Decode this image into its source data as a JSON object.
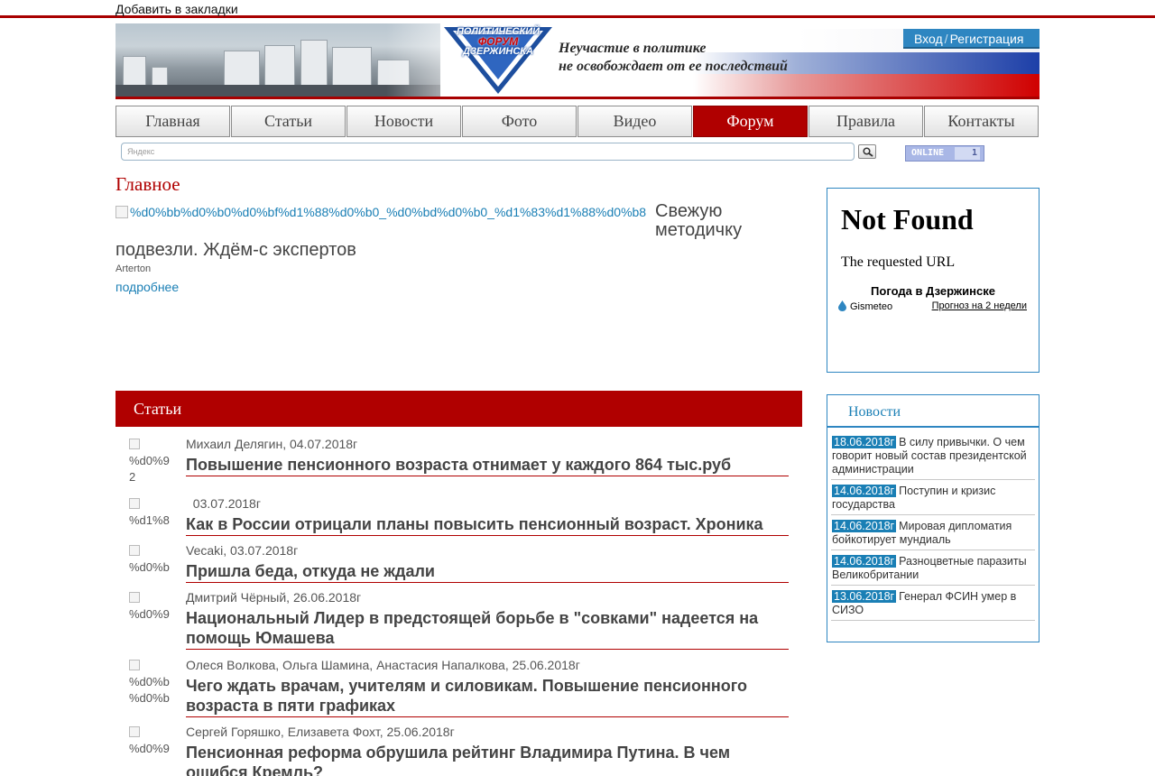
{
  "top": {
    "bookmark": "Добавить в закладки"
  },
  "header": {
    "logo_line1": "ПОЛИТИЧЕСКИЙ",
    "logo_line2": "ФОРУМ",
    "logo_line3": "ДЗЕРЖИНСКА",
    "slogan_line1": "Неучастие в политике",
    "slogan_line2": "не освобождает от ее последствий",
    "login": "Вход",
    "separator": "/",
    "register": "Регистрация"
  },
  "nav": [
    {
      "label": "Главная"
    },
    {
      "label": "Статьи"
    },
    {
      "label": "Новости"
    },
    {
      "label": "Фото"
    },
    {
      "label": "Видео"
    },
    {
      "label": "Форум",
      "active": true
    },
    {
      "label": "Правила"
    },
    {
      "label": "Контакты"
    }
  ],
  "search": {
    "placeholder": "Яндекс"
  },
  "online": {
    "label": "ONLINE",
    "count": "1"
  },
  "featured": {
    "heading": "Главное",
    "image_alt": "%d0%bb%d0%b0%d0%bf%d1%88%d0%b0_%d0%bd%d0%b0_%d1%83%d1%88%d0%b8",
    "title_part1": "Свежую методичку",
    "title_part2": "подвезли. Ждём-с экспертов",
    "author": "Arterton",
    "more": "подробнее"
  },
  "not_found": {
    "title": "Not Found",
    "text": "The requested URL",
    "weather_title": "Погода в Дзержинске",
    "weather_source": "Gismeteo",
    "weather_link": "Прогноз на 2 недели"
  },
  "news": {
    "heading": "Новости",
    "items": [
      {
        "date": "18.06.2018г",
        "text": "В силу привычки. О чем говорит новый состав президентской администрации"
      },
      {
        "date": "14.06.2018г",
        "text": "Поступин и кризис государства"
      },
      {
        "date": "14.06.2018г",
        "text": "Мировая дипломатия бойкотирует мундиаль"
      },
      {
        "date": "14.06.2018г",
        "text": "Разноцветные паразиты Великобритании"
      },
      {
        "date": "13.06.2018г",
        "text": "Генерал ФСИН умер в СИЗО"
      }
    ]
  },
  "articles": {
    "heading": "Статьи",
    "items": [
      {
        "thumb": "%d0%9",
        "thumb2": "2",
        "meta": "Михаил Делягин,  04.07.2018г",
        "title": "Повышение пенсионного возраста отнимает у каждого 864 тыс.руб"
      },
      {
        "thumb": "%d1%8",
        "thumb2": "",
        "meta": "  03.07.2018г",
        "title": "Как в России отрицали планы повысить пенсионный возраст. Хроника"
      },
      {
        "thumb": "%d0%b",
        "thumb2": "",
        "meta": "Vecaki,  03.07.2018г",
        "title": "Пришла беда, откуда не ждали"
      },
      {
        "thumb": "%d0%9",
        "thumb2": "",
        "meta": "Дмитрий Чёрный,  26.06.2018г",
        "title": "Национальный Лидер в предстоящей борьбе в \"совками\" надеется на помощь Юмашева"
      },
      {
        "thumb": "%d0%b",
        "thumb2": "%d0%b",
        "meta": "Олеся Волкова, Ольга Шамина, Анастасия Напалкова,  25.06.2018г",
        "title": "Чего ждать врачам, учителям и силовикам. Повышение пенсионного возраста в пяти графиках"
      },
      {
        "thumb": "%d0%9",
        "thumb2": "",
        "meta": "Сергей Горяшко, Елизавета Фохт,  25.06.2018г",
        "title": "Пенсионная реформа обрушила рейтинг Владимира Путина. В чем ошибся Кремль?"
      }
    ]
  }
}
